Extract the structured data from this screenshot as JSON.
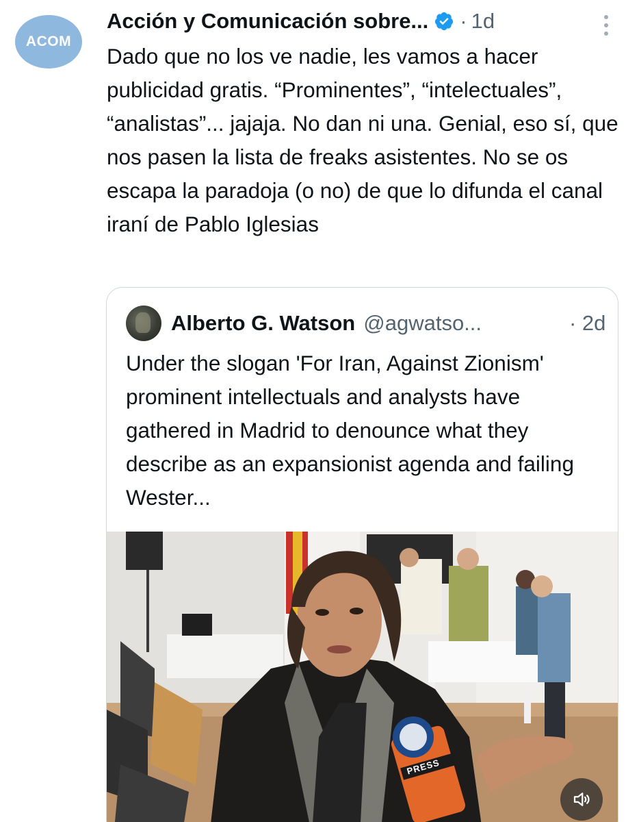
{
  "tweet": {
    "avatar_text": "ACOM",
    "author_name": "Acción y Comunicación sobre...",
    "separator": "·",
    "time": "1d",
    "text": "Dado que no los ve nadie, les vamos a hacer publicidad gratis. “Prominentes”, “intelectuales”, “analistas”... jajaja. No dan ni una. Genial, eso sí, que nos pasen la lista de freaks asistentes. No se os escapa la paradoja (o no) de que lo difunda el canal iraní de Pablo Iglesias"
  },
  "quote": {
    "author_name": "Alberto G. Watson",
    "handle": "@agwatso...",
    "time": "· 2d",
    "text": "Under the slogan 'For Iran, Against Zionism' prominent intellectuals and analysts have gathered in Madrid to denounce what they describe as an expansionist agenda and failing Wester...",
    "media_mic_label": "PRESS"
  },
  "colors": {
    "text": "#0f1419",
    "secondary": "#536471",
    "verified": "#1d9bf0",
    "avatar_bg": "#8fb8de",
    "border": "#cfd9de"
  },
  "icons": [
    "verified-badge-icon",
    "more-options-icon",
    "sound-icon"
  ]
}
